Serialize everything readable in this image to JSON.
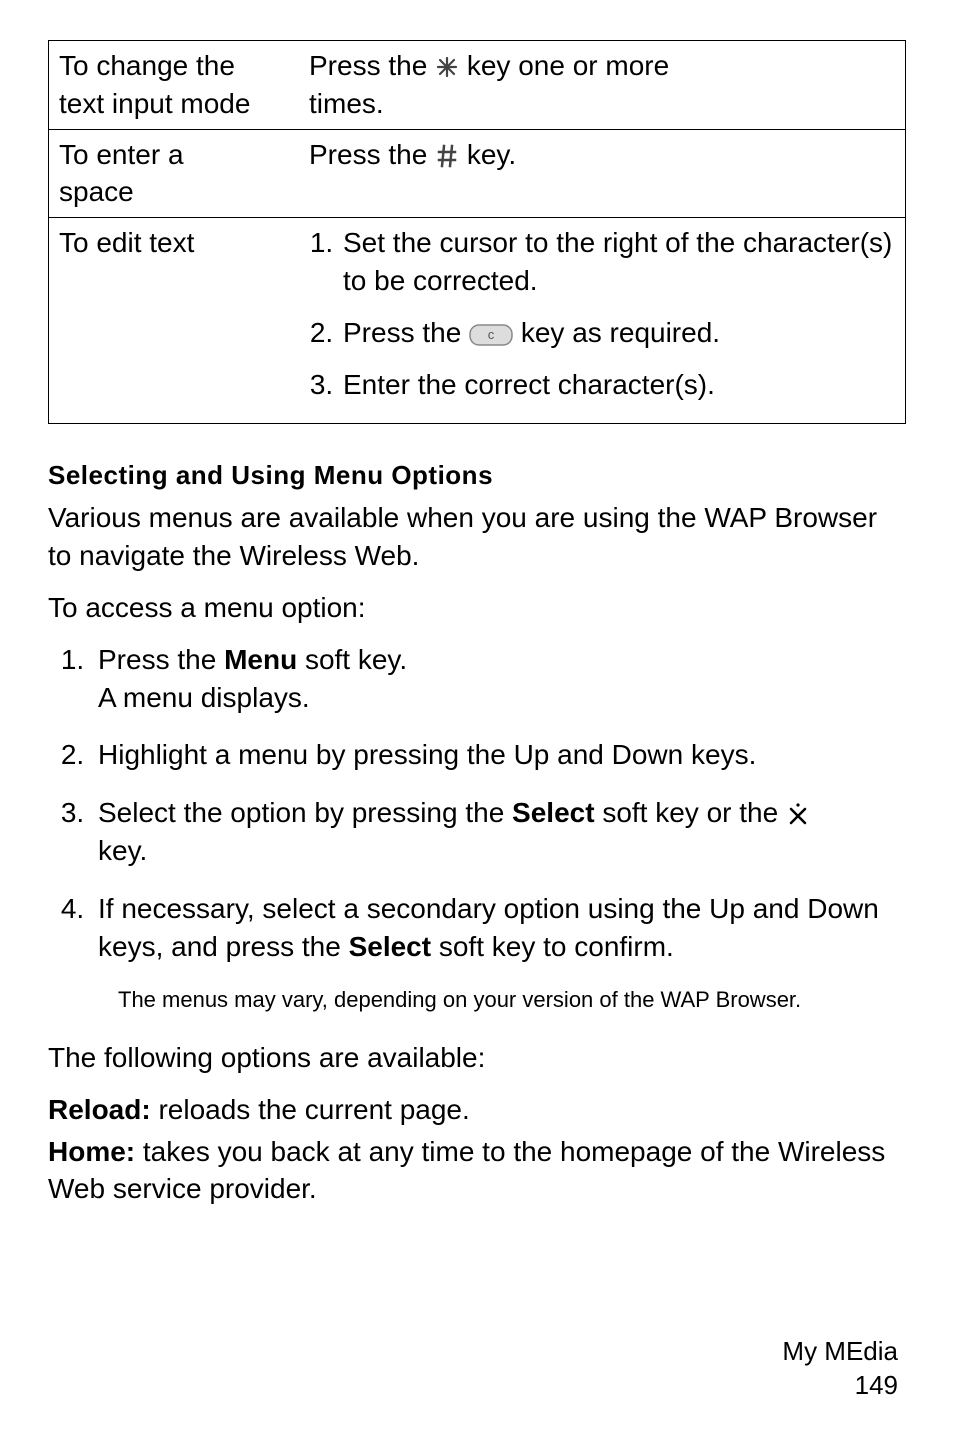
{
  "table": {
    "rows": [
      {
        "left_line1": "To change the",
        "left_line2": "text input mode",
        "right_pre": "Press the ",
        "right_icon": "star-icon",
        "right_mid": " key one or more",
        "right_post": "times."
      },
      {
        "left_line1": "To enter a",
        "left_line2": "space",
        "right_pre": "Press the ",
        "right_icon": "hash-icon",
        "right_mid": " key.",
        "right_post": ""
      },
      {
        "left_line1": "To edit text",
        "left_line2": "",
        "steps": [
          {
            "pre": "Set the cursor to the right of the character(s) to be corrected.",
            "icon": "",
            "post": ""
          },
          {
            "pre": "Press the ",
            "icon": "c-key-icon",
            "post": " key as required."
          },
          {
            "pre": "Enter the correct character(s).",
            "icon": "",
            "post": ""
          }
        ]
      }
    ]
  },
  "heading": "Selecting and Using Menu Options",
  "intro1": "Various menus are available when you are using the WAP Browser to navigate the Wireless Web.",
  "intro2": "To access a menu option:",
  "main_steps": [
    {
      "line1_pre": "Press the ",
      "line1_bold": "Menu",
      "line1_post": " soft key.",
      "line2": "A menu displays."
    },
    {
      "line1_pre": "Highlight a menu by pressing the Up and Down keys.",
      "line1_bold": "",
      "line1_post": ""
    },
    {
      "line1_pre": "Select the option by pressing the ",
      "line1_bold": "Select",
      "line1_post": " soft key or the ",
      "icon": "x-icon",
      "line2": "key."
    },
    {
      "line1_pre": "If necessary, select a secondary option using the Up and Down keys, and press the ",
      "line1_bold": "Select",
      "line1_post": " soft key to confirm."
    }
  ],
  "note": "The menus may vary, depending on your version of the WAP Browser.",
  "avail_intro": "The following options are available:",
  "options": [
    {
      "bold": "Reload:",
      "text": " reloads the current page."
    },
    {
      "bold": "Home:",
      "text": " takes you back at any time to the homepage of the Wireless Web service provider."
    }
  ],
  "footer1": "My MEdia",
  "footer2": "149"
}
